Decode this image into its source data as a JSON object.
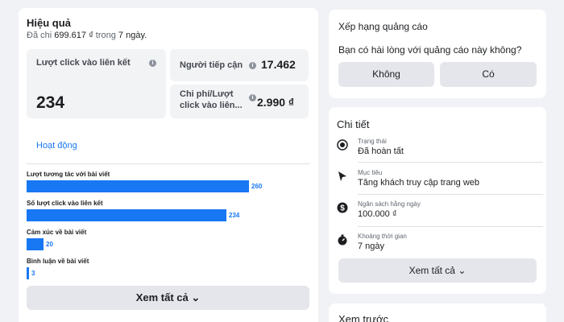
{
  "performance": {
    "title": "Hiệu quả",
    "subtitle_prefix": "Đã chi",
    "spent": "699.617 ₫",
    "subtitle_mid": "trong",
    "days": "7 ngày.",
    "link_clicks_label": "Lượt click vào liên kết",
    "link_clicks_value": "234",
    "reach_label": "Người tiếp cận",
    "reach_value": "17.462",
    "cpc_label_line1": "Chi phí/Lượt",
    "cpc_label_line2": "click vào liên...",
    "cpc_value": "2.990 ₫",
    "tab_activity": "Hoạt động",
    "bars": [
      {
        "label": "Lượt tương tác với bài viết",
        "value": 260
      },
      {
        "label": "Số lượt click vào liên kết",
        "value": 234
      },
      {
        "label": "Cảm xúc về bài viết",
        "value": 20
      },
      {
        "label": "Bình luận về bài viết",
        "value": 3
      }
    ],
    "see_all": "Xem tất cả ⌄"
  },
  "rating": {
    "title": "Xếp hạng quảng cáo",
    "question": "Bạn có hài lòng với quảng cáo này không?",
    "no_label": "Không",
    "yes_label": "Có"
  },
  "details": {
    "title": "Chi tiết",
    "status_caption": "Trạng thái",
    "status_value": "Đã hoàn tất",
    "goal_caption": "Mục tiêu",
    "goal_value": "Tăng khách truy cập trang web",
    "budget_caption": "Ngân sách hằng ngày",
    "budget_value": "100.000 ₫",
    "duration_caption": "Khoảng thời gian",
    "duration_value": "7 ngày",
    "see_all": "Xem tất cả ⌄"
  },
  "preview": {
    "title": "Xem trước"
  }
}
